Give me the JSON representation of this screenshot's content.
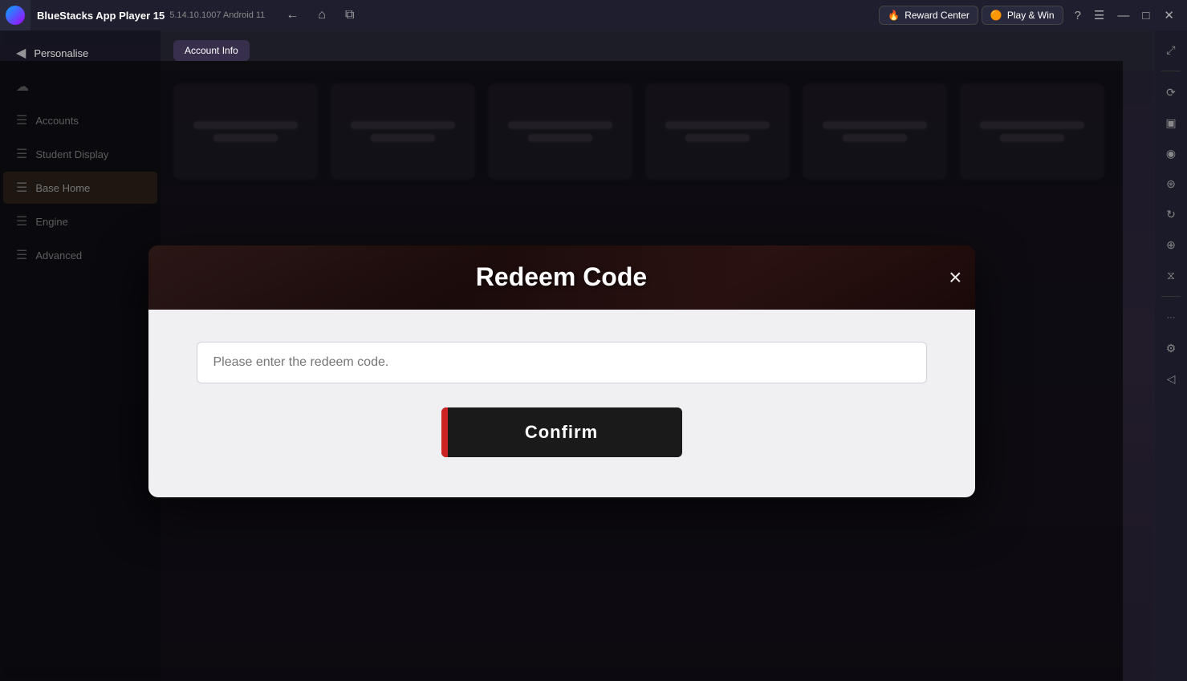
{
  "titlebar": {
    "app_name": "BlueStacks App Player 15",
    "version": "5.14.10.1007  Android 11",
    "reward_center_label": "Reward Center",
    "play_win_label": "Play & Win",
    "reward_icon": "🔥",
    "play_icon": "🟠",
    "nav": {
      "back": "←",
      "home": "⌂",
      "tabs": "⧉"
    },
    "window_controls": {
      "help": "?",
      "menu": "☰",
      "minimize": "—",
      "maximize": "□",
      "close": "✕",
      "expand": "⤢"
    }
  },
  "sidebar": {
    "items": [
      {
        "id": "personalise",
        "label": "Personalise",
        "icon": "◀"
      },
      {
        "id": "cloud",
        "label": "",
        "icon": "☁"
      },
      {
        "id": "account",
        "label": "Accounts",
        "icon": "☰"
      },
      {
        "id": "student-display",
        "label": "Student Display",
        "icon": "☰"
      },
      {
        "id": "base-home",
        "label": "Base Home",
        "icon": "☰",
        "active": true
      },
      {
        "id": "engine",
        "label": "Engine",
        "icon": "☰"
      },
      {
        "id": "advanced",
        "label": "Advanced",
        "icon": "☰"
      }
    ]
  },
  "top_tabs": [
    {
      "label": "Account Info",
      "active": true
    },
    {
      "label": "...",
      "active": false
    }
  ],
  "modal": {
    "title": "Redeem Code",
    "close_label": "×",
    "input_placeholder": "Please enter the redeem code.",
    "confirm_label": "Confirm"
  },
  "right_sidebar": {
    "buttons": [
      {
        "id": "expand",
        "icon": "⤢"
      },
      {
        "id": "sync",
        "icon": "⟳"
      },
      {
        "id": "screenshot",
        "icon": "⬛"
      },
      {
        "id": "record",
        "icon": "◉"
      },
      {
        "id": "fps",
        "icon": "◈"
      },
      {
        "id": "rotate",
        "icon": "↻"
      },
      {
        "id": "zoom",
        "icon": "⊕"
      },
      {
        "id": "macro",
        "icon": "⧖"
      },
      {
        "id": "more",
        "icon": "···"
      },
      {
        "id": "settings",
        "icon": "⚙"
      },
      {
        "id": "arrow",
        "icon": "◁"
      }
    ]
  }
}
